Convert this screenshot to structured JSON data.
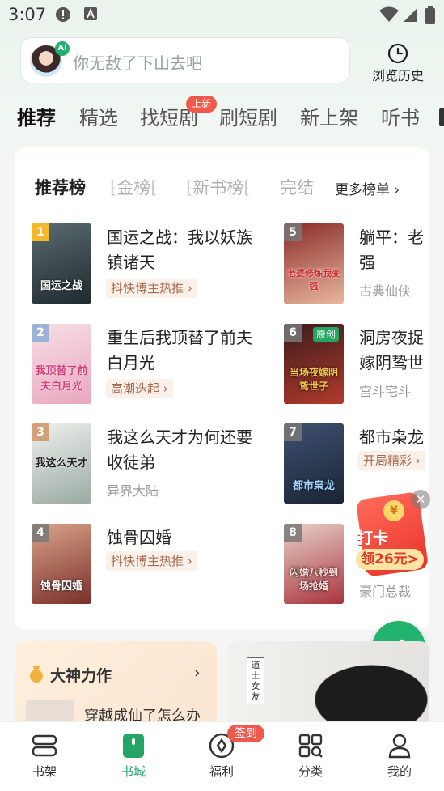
{
  "status_bar": {
    "time": "3:07"
  },
  "search": {
    "placeholder": "你无敌了下山去吧",
    "ai_badge": "Ai"
  },
  "history": {
    "label": "浏览历史"
  },
  "tabs": [
    {
      "label": "推荐"
    },
    {
      "label": "精选"
    },
    {
      "label": "找短剧"
    },
    {
      "label": "刷短剧"
    },
    {
      "label": "新上架"
    },
    {
      "label": "听书"
    }
  ],
  "tab_badge": "上新",
  "ranking": {
    "subtabs": [
      {
        "label": "推荐榜"
      },
      {
        "label": "金榜"
      },
      {
        "label": "新书榜"
      },
      {
        "label": "完结"
      }
    ],
    "more_label": "更多榜单 ›",
    "books": [
      {
        "rank": "1",
        "title": "国运之战：我以妖族镇诸天",
        "tag": "抖快博主热推",
        "cover_text": "国运之战"
      },
      {
        "rank": "2",
        "title": "重生后我顶替了前夫白月光",
        "tag": "高潮迭起",
        "cover_text": "我顶替了前夫白月光"
      },
      {
        "rank": "3",
        "title": "我这么天才为何还要收徒弟",
        "genre": "异界大陆",
        "cover_text": "我这么天才"
      },
      {
        "rank": "4",
        "title": "蚀骨囚婚",
        "tag": "抖快博主热推",
        "cover_text": "蚀骨囚婚"
      },
      {
        "rank": "5",
        "title": "躺平：老",
        "title_line2": "强",
        "genre": "古典仙侠",
        "cover_text": "老婆修炼我变强"
      },
      {
        "rank": "6",
        "title": "洞房夜捉",
        "title_line2": "嫁阴鸷世",
        "genre": "宫斗宅斗",
        "orig_badge": "原创",
        "cover_text": "当场夜嫁阴鸷世子"
      },
      {
        "rank": "7",
        "title": "都市枭龙",
        "tag": "开局精彩",
        "cover_text": "都市枭龙"
      },
      {
        "rank": "8",
        "title": "",
        "genre": "豪门总裁",
        "cover_text": "闪婚八秒到场抢婚"
      }
    ]
  },
  "promo": {
    "line1": "打卡",
    "line2": "领26元>",
    "coin": "¥"
  },
  "god_card": {
    "title": "大神力作",
    "preview": "穿越成仙了怎么办"
  },
  "banner": {
    "label": "道士女友"
  },
  "bottom_nav": [
    {
      "label": "书架"
    },
    {
      "label": "书城"
    },
    {
      "label": "福利"
    },
    {
      "label": "分类"
    },
    {
      "label": "我的"
    }
  ],
  "nav_badge": "签到",
  "colors": {
    "accent": "#22b46f",
    "badge_red": "#f0584c",
    "tag_text": "#a86a4c"
  }
}
